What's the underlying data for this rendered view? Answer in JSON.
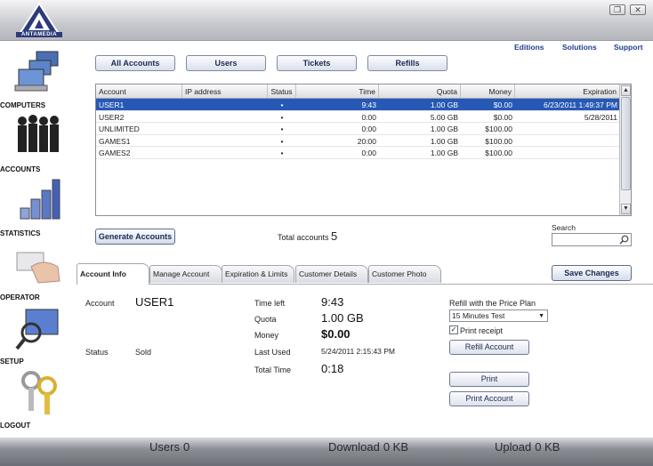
{
  "app": {
    "logo_text": "ANTAMEDIA"
  },
  "window_buttons": [
    {
      "name": "restore",
      "glyph": "❐"
    },
    {
      "name": "close",
      "glyph": "✕"
    }
  ],
  "sidebar": {
    "items": [
      {
        "label": "COMPUTERS",
        "icon": "computers-icon"
      },
      {
        "label": "ACCOUNTS",
        "icon": "accounts-icon"
      },
      {
        "label": "STATISTICS",
        "icon": "statistics-icon"
      },
      {
        "label": "OPERATOR",
        "icon": "operator-icon"
      },
      {
        "label": "SETUP",
        "icon": "setup-icon"
      },
      {
        "label": "LOGOUT",
        "icon": "logout-icon"
      }
    ]
  },
  "toplinks": {
    "editions": "Editions",
    "solutions": "Solutions",
    "support": "Support"
  },
  "nav": {
    "all_accounts": "All Accounts",
    "users": "Users",
    "tickets": "Tickets",
    "refills": "Refills"
  },
  "grid": {
    "columns": [
      "Account",
      "IP address",
      "Status",
      "Time",
      "Quota",
      "Money",
      "Expiration"
    ],
    "rows": [
      {
        "account": "USER1",
        "ip": "",
        "status": "•",
        "time": "9:43",
        "quota": "1.00 GB",
        "money": "$0.00",
        "expiration": "6/23/2011 1:49:37 PM",
        "selected": true
      },
      {
        "account": "USER2",
        "ip": "",
        "status": "•",
        "time": "0:00",
        "quota": "5.00 GB",
        "money": "$0.00",
        "expiration": "5/28/2011",
        "selected": false
      },
      {
        "account": "UNLIMITED",
        "ip": "",
        "status": "•",
        "time": "0:00",
        "quota": "1.00 GB",
        "money": "$100.00",
        "expiration": "",
        "selected": false
      },
      {
        "account": "GAMES1",
        "ip": "",
        "status": "•",
        "time": "20:00",
        "quota": "1.00 GB",
        "money": "$100.00",
        "expiration": "",
        "selected": false
      },
      {
        "account": "GAMES2",
        "ip": "",
        "status": "•",
        "time": "0:00",
        "quota": "1.00 GB",
        "money": "$100.00",
        "expiration": "",
        "selected": false
      }
    ]
  },
  "generate_accounts": "Generate Accounts",
  "total_accounts": {
    "label": "Total accounts",
    "value": "5"
  },
  "search": {
    "label": "Search",
    "value": ""
  },
  "tabs": [
    "Account Info",
    "Manage Account",
    "Expiration & Limits",
    "Customer Details",
    "Customer Photo"
  ],
  "save_changes": "Save Changes",
  "info": {
    "account_label": "Account",
    "account_value": "USER1",
    "status_label": "Status",
    "status_value": "Sold",
    "time_left_label": "Time left",
    "time_left_value": "9:43",
    "quota_label": "Quota",
    "quota_value": "1.00 GB",
    "money_label": "Money",
    "money_value": "$0.00",
    "last_used_label": "Last Used",
    "last_used_value": "5/24/2011 2:15:43 PM",
    "total_time_label": "Total Time",
    "total_time_value": "0:18"
  },
  "refill": {
    "label": "Refill with the Price Plan",
    "selected_plan": "15 Minutes Test",
    "print_receipt_label": "Print receipt",
    "print_receipt_checked": true,
    "refill_button": "Refill Account",
    "print_button": "Print",
    "print_account_button": "Print Account"
  },
  "statusbar": {
    "users_label": "Users",
    "users_value": "0",
    "download_label": "Download",
    "download_value": "0 KB",
    "upload_label": "Upload",
    "upload_value": "0 KB"
  }
}
